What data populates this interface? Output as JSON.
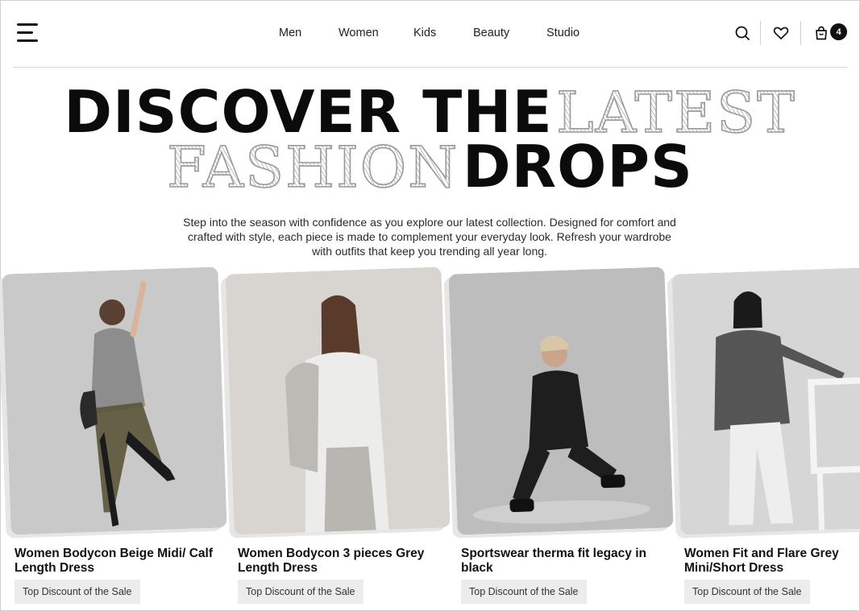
{
  "nav": {
    "items": [
      "Men",
      "Women",
      "Kids",
      "Beauty",
      "Studio"
    ],
    "cart_count": "4"
  },
  "icons": {
    "menu": "hamburger-menu-icon",
    "search": "search-icon",
    "wishlist": "heart-icon",
    "cart": "shopping-bag-icon"
  },
  "hero": {
    "bold_1": "DISCOVER THE",
    "sketch_1": "LATEST",
    "sketch_2": "FASHION",
    "bold_2": "DROPS",
    "description": "Step into the season with confidence as you explore our latest collection. Designed for comfort and crafted with style, each piece is made to complement your everyday look. Refresh your wardrobe with outfits that keep you trending all year long."
  },
  "products": [
    {
      "name": "Women Bodycon Beige Midi/ Calf Length Dress",
      "tag": "Top Discount of the Sale",
      "bg": "#c9c9c9"
    },
    {
      "name": "Women Bodycon 3 pieces Grey Length Dress",
      "tag": "Top Discount of the Sale",
      "bg": "#d8d4d0"
    },
    {
      "name": "Sportswear therma fit legacy in black",
      "tag": "Top Discount of the Sale",
      "bg": "#bdbdbd"
    },
    {
      "name": "Women Fit and Flare Grey Mini/Short Dress",
      "tag": "Top Discount of the Sale",
      "bg": "#d6d6d6"
    }
  ]
}
